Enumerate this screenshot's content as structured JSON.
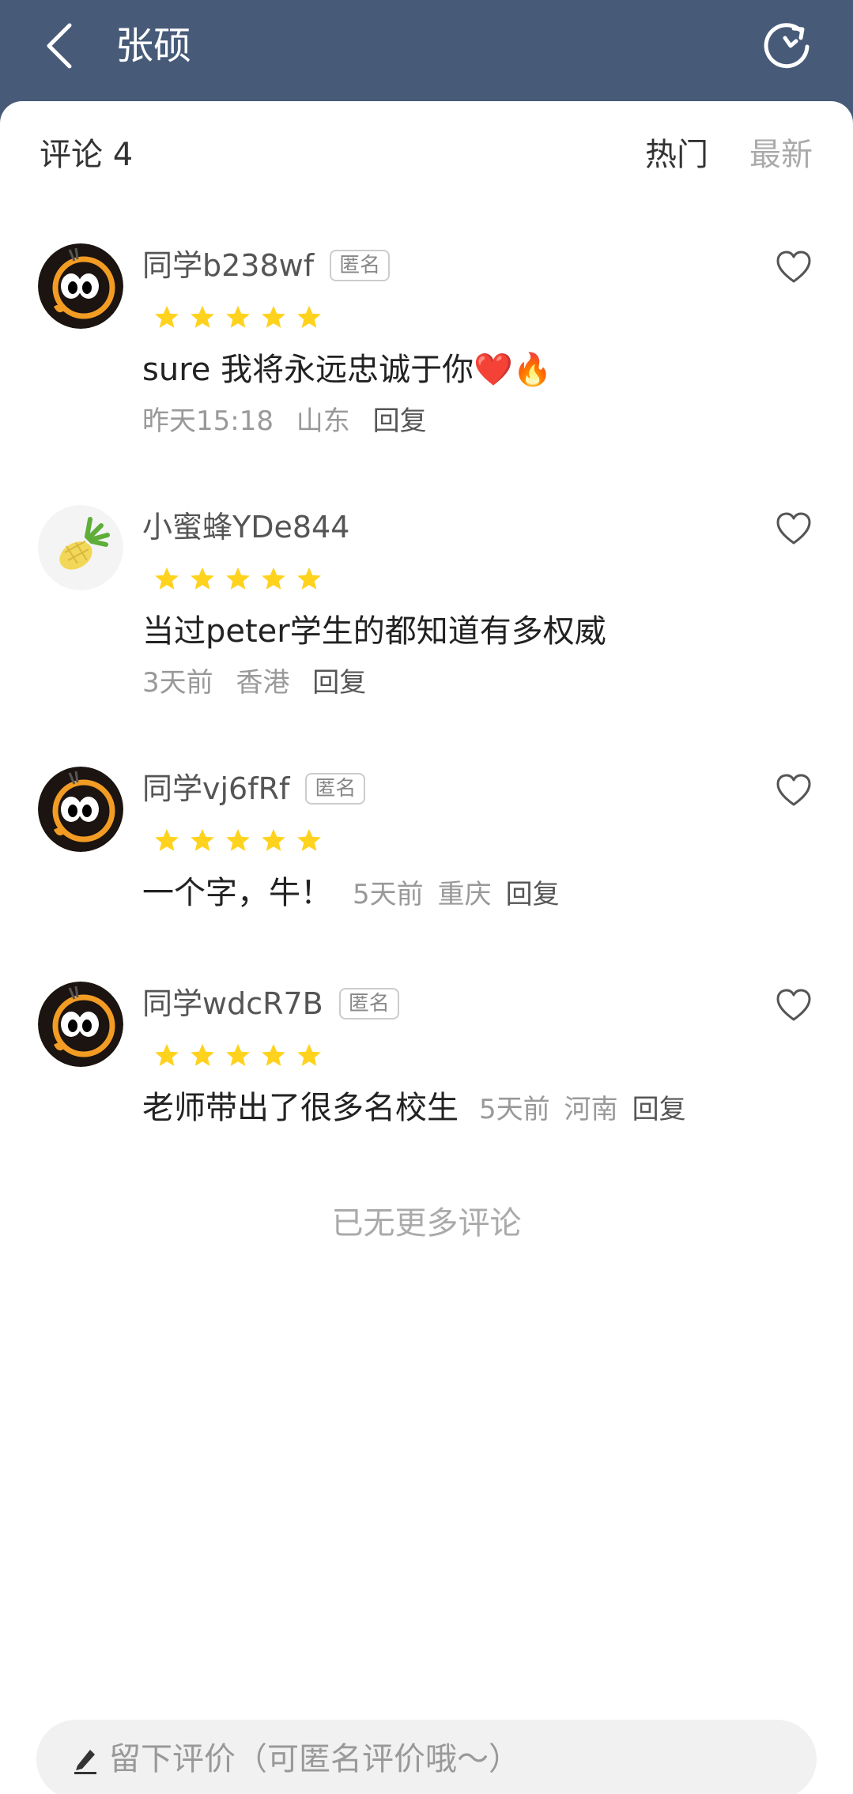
{
  "header": {
    "title": "张硕",
    "back_icon": "chevron-left-icon",
    "refresh_icon": "refresh-icon",
    "background": "#475a78"
  },
  "comments_section": {
    "count_label": "评论 4",
    "sort_hot": "热门",
    "sort_new": "最新",
    "active_sort": "热门"
  },
  "comments": [
    {
      "username": "同学b238wf",
      "badge": "匿名",
      "avatar": "cartoon-eyes-avatar",
      "rating": 5,
      "text": "sure 我将永远忠诚于你❤️🔥",
      "time": "昨天15:18",
      "location": "山东",
      "reply": "回复"
    },
    {
      "username": "小蜜蜂YDe844",
      "badge": "",
      "avatar": "pineapple-avatar",
      "rating": 5,
      "text": "当过peter学生的都知道有多权威",
      "time": "3天前",
      "location": "香港",
      "reply": "回复"
    },
    {
      "username": "同学vj6fRf",
      "badge": "匿名",
      "avatar": "cartoon-eyes-avatar",
      "rating": 5,
      "text": "一个字，牛！",
      "time": "5天前",
      "location": "重庆",
      "reply": "回复"
    },
    {
      "username": "同学wdcR7B",
      "badge": "匿名",
      "avatar": "cartoon-eyes-avatar",
      "rating": 5,
      "text": "老师带出了很多名校生",
      "time": "5天前",
      "location": "河南",
      "reply": "回复"
    }
  ],
  "footer_note": "已无更多评论",
  "compose": {
    "placeholder": "留下评价（可匿名评价哦～）",
    "icon": "pencil-icon"
  },
  "colors": {
    "star": "#ffd21e",
    "avatar_ring": "#f39c24"
  }
}
